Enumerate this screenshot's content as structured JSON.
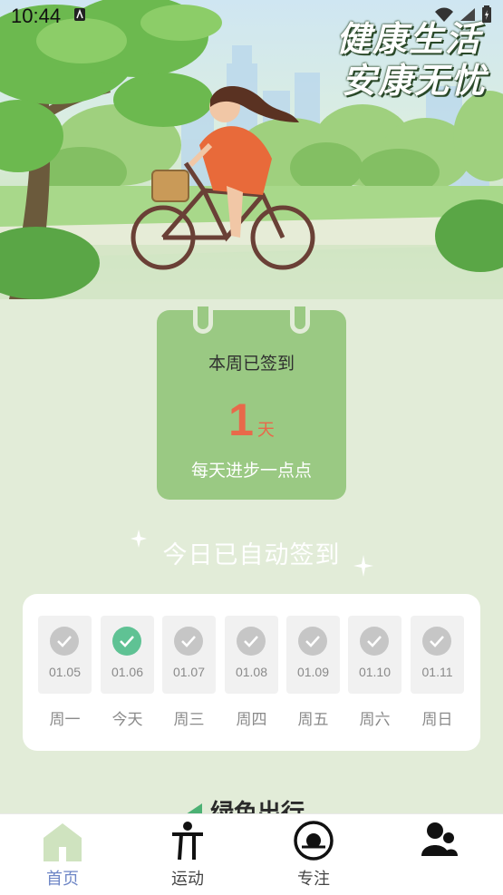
{
  "status_bar": {
    "time": "10:44"
  },
  "hero": {
    "slogan_line1": "健康生活",
    "slogan_line2": "安康无忧"
  },
  "checkin_card": {
    "title": "本周已签到",
    "count": "1",
    "unit": "天",
    "subtitle": "每天进步一点点"
  },
  "auto_checkin": {
    "text": "今日已自动签到"
  },
  "week": {
    "days": [
      {
        "date": "01.05",
        "label": "周一",
        "checked": false
      },
      {
        "date": "01.06",
        "label": "今天",
        "checked": true
      },
      {
        "date": "01.07",
        "label": "周三",
        "checked": false
      },
      {
        "date": "01.08",
        "label": "周四",
        "checked": false
      },
      {
        "date": "01.09",
        "label": "周五",
        "checked": false
      },
      {
        "date": "01.10",
        "label": "周六",
        "checked": false
      },
      {
        "date": "01.11",
        "label": "周日",
        "checked": false
      }
    ]
  },
  "next_section": {
    "title": "绿色出行"
  },
  "tabbar": {
    "tabs": [
      {
        "label": "首页",
        "icon": "home-icon",
        "active": true
      },
      {
        "label": "运动",
        "icon": "exercise-icon",
        "active": false
      },
      {
        "label": "专注",
        "icon": "focus-icon",
        "active": false
      },
      {
        "label": "",
        "icon": "profile-icon",
        "active": false
      }
    ]
  },
  "colors": {
    "page_bg": "#e2ecd8",
    "card_green": "#9ac983",
    "count_red": "#e8694a",
    "check_green": "#5fc294",
    "tab_active": "#6e86c6"
  }
}
